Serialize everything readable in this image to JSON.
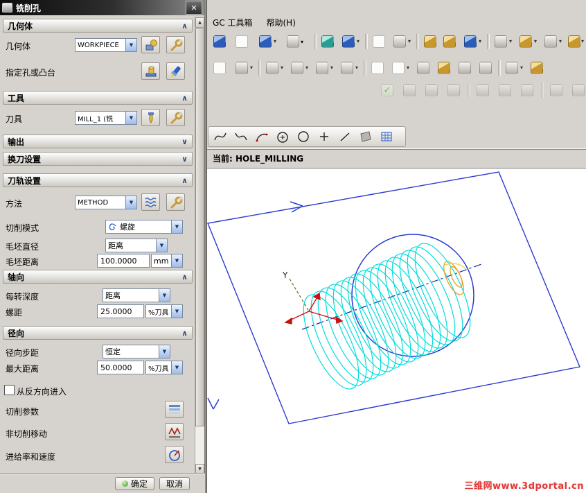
{
  "glyphs": {
    "close": "✕",
    "combo_arrow": "▼",
    "collapse": "∧",
    "expand": "∨",
    "scroll_up": "▲",
    "scroll_down": "▼",
    "menu_arrow": "▾",
    "checkmark": "✓"
  },
  "dialog": {
    "title": "铣削孔",
    "sections": {
      "geometry": "几何体",
      "tool": "工具",
      "output": "输出",
      "tool_change": "换刀设置",
      "path_settings": "刀轨设置",
      "axial": "轴向",
      "radial": "径向"
    },
    "fields": {
      "geometry_label": "几何体",
      "geometry_value": "WORKPIECE",
      "specify_label": "指定孔或凸台",
      "tool_label": "刀具",
      "tool_value": "MILL_1 (铣",
      "method_label": "方法",
      "method_value": "METHOD",
      "cut_mode_label": "切削模式",
      "cut_mode_value": "螺旋",
      "blank_dia_label": "毛坯直径",
      "blank_dia_value": "距离",
      "blank_dist_label": "毛坯距离",
      "blank_dist_value": "100.0000",
      "blank_dist_unit": "mm",
      "depth_label": "每转深度",
      "depth_value": "距离",
      "pitch_label": "螺距",
      "pitch_value": "25.0000",
      "pitch_unit": "%刀具",
      "radial_step_label": "径向步距",
      "radial_step_value": "恒定",
      "max_dist_label": "最大距离",
      "max_dist_value": "50.0000",
      "max_dist_unit": "%刀具",
      "reverse_label": "从反方向进入",
      "cut_params_label": "切削参数",
      "non_cutting_label": "非切削移动",
      "feeds_label": "进给率和速度"
    },
    "buttons": {
      "ok": "确定",
      "cancel": "取消"
    }
  },
  "menu": {
    "gc_toolbox": "GC 工具箱",
    "help": "帮助(H)"
  },
  "status": {
    "current": "当前: HOLE_MILLING"
  },
  "viewport": {
    "watermark": "三维网www.3dportal.cn",
    "y_axis_label": "Y"
  },
  "colors": {
    "toolpath_cyan": "#00dcdc",
    "geometry_blue": "#2a3bd0",
    "engage_orange": "#e8a020",
    "watermark_red": "#e03a3a"
  }
}
